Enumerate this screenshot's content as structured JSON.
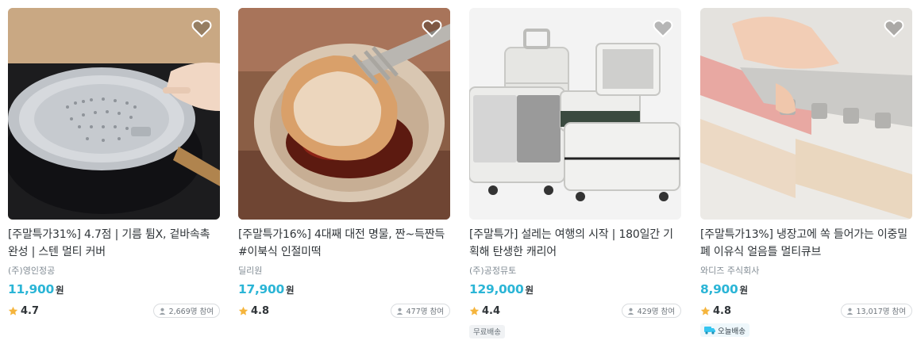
{
  "products": [
    {
      "title": "[주말특가31%] 4.7점 | 기름 튐X, 겉바속촉 완성 | 스텐 멀티 커버",
      "brand": "(주)영인정공",
      "price": "11,900",
      "currency": "원",
      "rating": "4.7",
      "participants": "2,669명 참여",
      "badge": "",
      "image_icon": "stainless-pan-cover-photo"
    },
    {
      "title": "[주말특가16%] 4대째 대전 명물, 짠~득짠득 #이북식 인절미떡",
      "brand": "딜리원",
      "price": "17,900",
      "currency": "원",
      "rating": "4.8",
      "participants": "477명 참여",
      "badge": "",
      "image_icon": "injeolmi-rice-cake-photo"
    },
    {
      "title": "[주말특가] 설레는 여행의 시작 | 180일간 기획해 탄생한 캐리어",
      "brand": "(주)공정뮤토",
      "price": "129,000",
      "currency": "원",
      "rating": "4.4",
      "participants": "429명 참여",
      "badge": "무료배송",
      "image_icon": "suitcase-set-photo"
    },
    {
      "title": "[주말특가13%] 냉장고에 쏙 들어가는 이중밀폐 이유식 얼음틀 멀티큐브",
      "brand": "와디즈 주식회사",
      "price": "8,900",
      "currency": "원",
      "rating": "4.8",
      "participants": "13,017명 참여",
      "badge": "오늘배송",
      "image_icon": "ice-cube-tray-photo"
    }
  ],
  "colors": {
    "price": "#2bb5d6",
    "star": "#f5b53d",
    "brand_text": "#828c94",
    "badge_bg": "#f0f2f4",
    "truck": "#35c5f0"
  }
}
